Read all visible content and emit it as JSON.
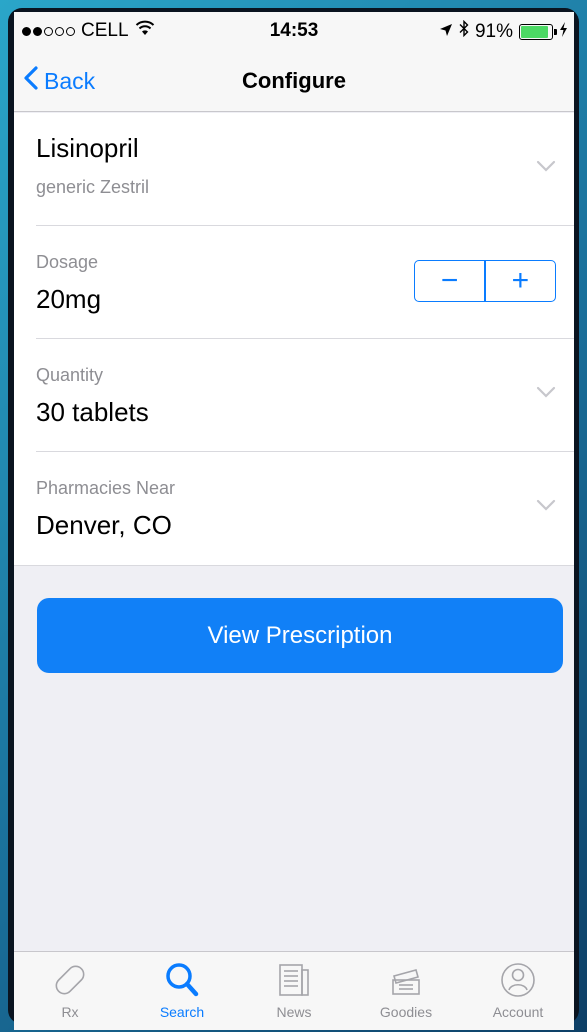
{
  "status_bar": {
    "carrier": "CELL",
    "time": "14:53",
    "battery": "91%",
    "battery_level": 0.91,
    "signal_bars_filled": 2,
    "signal_bars_total": 5
  },
  "nav": {
    "back_label": "Back",
    "title": "Configure"
  },
  "drug": {
    "name": "Lisinopril",
    "generic": "generic Zestril"
  },
  "dosage": {
    "label": "Dosage",
    "value": "20mg",
    "decrement": "−",
    "increment": "+"
  },
  "quantity": {
    "label": "Quantity",
    "value": "30 tablets"
  },
  "pharmacy": {
    "label": "Pharmacies Near",
    "value": "Denver, CO"
  },
  "primary_action": {
    "label": "View Prescription"
  },
  "tabs": [
    {
      "label": "Rx",
      "icon": "pill-icon",
      "active": false
    },
    {
      "label": "Search",
      "icon": "search-icon",
      "active": true
    },
    {
      "label": "News",
      "icon": "newspaper-icon",
      "active": false
    },
    {
      "label": "Goodies",
      "icon": "gift-icon",
      "active": false
    },
    {
      "label": "Account",
      "icon": "user-icon",
      "active": false
    }
  ],
  "colors": {
    "accent": "#0a7cff",
    "button": "#1180f7",
    "background": "#efeff4",
    "secondary_text": "#8e8e93"
  }
}
